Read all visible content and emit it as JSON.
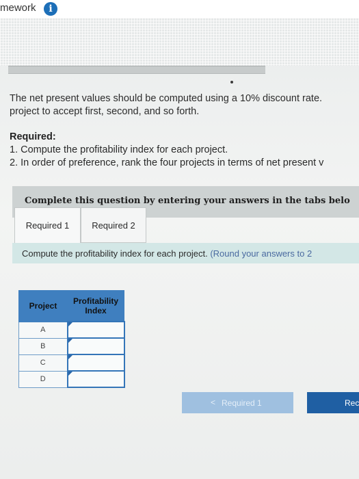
{
  "header": {
    "title": "mework",
    "info_icon": "info-icon",
    "info_glyph": "i"
  },
  "faded_values": [
    "",
    "",
    ""
  ],
  "intro": {
    "line1": "The net present values should be computed using a 10% discount rate.",
    "line2": "project to accept first, second, and so forth."
  },
  "required": {
    "heading": "Required:",
    "item1": "1. Compute the profitability index for each project.",
    "item2": "2. In order of preference, rank the four projects in terms of net present v"
  },
  "banner": {
    "text": "Complete this question by entering your answers in the tabs belo"
  },
  "tabs": [
    {
      "label": "Required 1",
      "active": true
    },
    {
      "label": "Required 2",
      "active": false
    }
  ],
  "instruction": {
    "main": "Compute the profitability index for each project.",
    "hint": "(Round your answers to 2"
  },
  "table": {
    "headers": {
      "project": "Project",
      "pi_line1": "Profitability",
      "pi_line2": "Index"
    },
    "rows": [
      {
        "project": "A",
        "value": ""
      },
      {
        "project": "B",
        "value": ""
      },
      {
        "project": "C",
        "value": ""
      },
      {
        "project": "D",
        "value": ""
      }
    ]
  },
  "nav": {
    "prev_chevron": "<",
    "prev_label": "Required 1",
    "next_label": "Rec"
  },
  "colors": {
    "accent_blue": "#1f5fa3",
    "table_header": "#3f7fbf",
    "instruction_bg": "#d3e7e6",
    "banner_bg": "#cdd2d2"
  }
}
